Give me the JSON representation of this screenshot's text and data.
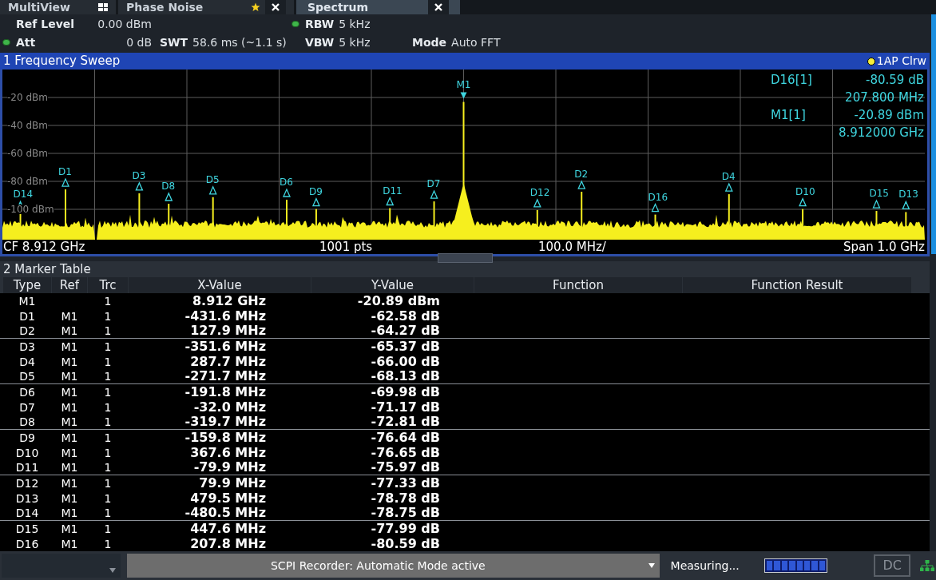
{
  "tabs": [
    {
      "label": "MultiView",
      "selected": false,
      "kind": "overview",
      "closable": false
    },
    {
      "label": "Phase Noise",
      "selected": false,
      "kind": "favorite",
      "closable": true
    },
    {
      "label": "Spectrum",
      "selected": true,
      "kind": "plain",
      "closable": true
    }
  ],
  "settings": [
    [
      {
        "label": "Ref Level",
        "value": "0.00 dBm",
        "dot": false
      },
      {
        "label": "RBW",
        "value": "5 kHz",
        "dot": true
      }
    ],
    [
      {
        "label": "Att",
        "value": "0 dB",
        "dot": true
      },
      {
        "label": "SWT",
        "value": "58.6 ms (~1.1 s)",
        "dot": false
      },
      {
        "label": "VBW",
        "value": "5 kHz",
        "dot": false
      },
      {
        "label": "Mode",
        "value": "Auto FFT",
        "dot": false
      }
    ]
  ],
  "sweep": {
    "title": "1 Frequency Sweep",
    "trace_label": "1AP Clrw",
    "y_labels": [
      "-20 dBm",
      "-40 dBm",
      "-60 dBm",
      "-80 dBm",
      "-100 dBm"
    ],
    "marker_info": [
      {
        "name": "D16[1]",
        "value": "-80.59 dB",
        "position": "207.800 MHz"
      },
      {
        "name": "M1[1]",
        "value": "-20.89 dBm",
        "position": "8.912000 GHz"
      }
    ],
    "markers": [
      "D14",
      "D1",
      "D3",
      "D8",
      "D5",
      "D6",
      "D9",
      "D11",
      "D7",
      "M1",
      "D12",
      "D2",
      "D16",
      "D4",
      "D10",
      "D15",
      "D13"
    ],
    "footer": {
      "center": "CF 8.912 GHz",
      "points": "1001 pts",
      "division": "100.0 MHz/",
      "span": "Span 1.0 GHz"
    }
  },
  "marker_table": {
    "title": "2 Marker Table",
    "columns": [
      "Type",
      "Ref",
      "Trc",
      "X-Value",
      "Y-Value",
      "Function",
      "Function Result"
    ],
    "rows": [
      [
        "M1",
        "",
        "1",
        "8.912 GHz",
        "-20.89 dBm"
      ],
      [
        "D1",
        "M1",
        "1",
        "-431.6 MHz",
        "-62.58 dB"
      ],
      [
        "D2",
        "M1",
        "1",
        "127.9 MHz",
        "-64.27 dB"
      ],
      [
        "D3",
        "M1",
        "1",
        "-351.6 MHz",
        "-65.37 dB"
      ],
      [
        "D4",
        "M1",
        "1",
        "287.7 MHz",
        "-66.00 dB"
      ],
      [
        "D5",
        "M1",
        "1",
        "-271.7 MHz",
        "-68.13 dB"
      ],
      [
        "D6",
        "M1",
        "1",
        "-191.8 MHz",
        "-69.98 dB"
      ],
      [
        "D7",
        "M1",
        "1",
        "-32.0 MHz",
        "-71.17 dB"
      ],
      [
        "D8",
        "M1",
        "1",
        "-319.7 MHz",
        "-72.81 dB"
      ],
      [
        "D9",
        "M1",
        "1",
        "-159.8 MHz",
        "-76.64 dB"
      ],
      [
        "D10",
        "M1",
        "1",
        "367.6 MHz",
        "-76.65 dB"
      ],
      [
        "D11",
        "M1",
        "1",
        "-79.9 MHz",
        "-75.97 dB"
      ],
      [
        "D12",
        "M1",
        "1",
        "79.9 MHz",
        "-77.33 dB"
      ],
      [
        "D13",
        "M1",
        "1",
        "479.5 MHz",
        "-78.78 dB"
      ],
      [
        "D14",
        "M1",
        "1",
        "-480.5 MHz",
        "-78.75 dB"
      ],
      [
        "D15",
        "M1",
        "1",
        "447.6 MHz",
        "-77.99 dB"
      ],
      [
        "D16",
        "M1",
        "1",
        "207.8 MHz",
        "-80.59 dB"
      ]
    ]
  },
  "status_bar": {
    "recorder": "SCPI Recorder: Automatic Mode active",
    "state": "Measuring...",
    "coupling": "DC"
  }
}
